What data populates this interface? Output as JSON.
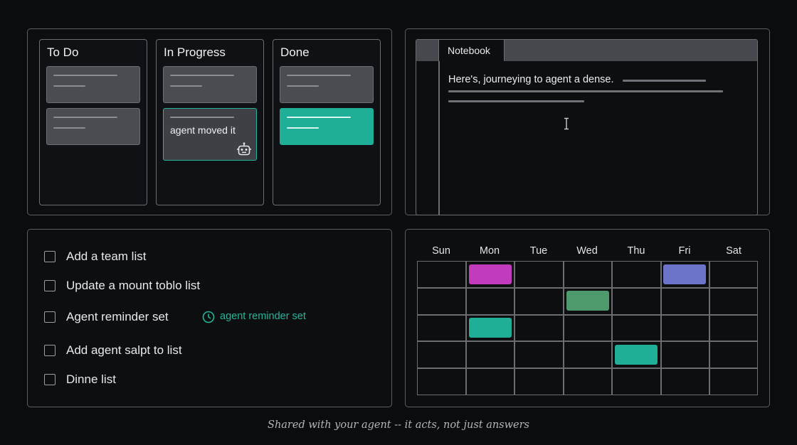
{
  "kanban": {
    "columns": [
      {
        "title": "To Do"
      },
      {
        "title": "In Progress"
      },
      {
        "title": "Done"
      }
    ],
    "agent_card_text": "agent moved it",
    "agent_icon": "robot-icon"
  },
  "notebook": {
    "tab_label": "Notebook",
    "text": "Here's, journeying to agent a dense.",
    "cursor_icon": "text-cursor-icon"
  },
  "todo": {
    "items": [
      {
        "label": "Add a team list",
        "checked": false
      },
      {
        "label": "Update a mount toblo list",
        "checked": false
      },
      {
        "label": "Agent reminder set",
        "checked": false
      },
      {
        "label": "Add agent salpt to list",
        "checked": false
      },
      {
        "label": "Dinne list",
        "checked": false
      }
    ],
    "reminder_badge": "agent reminder set",
    "reminder_icon": "clock-icon"
  },
  "calendar": {
    "days": [
      "Sun",
      "Mon",
      "Tue",
      "Wed",
      "Thu",
      "Fri",
      "Sat"
    ],
    "events": [
      {
        "day": "Mon",
        "row": 1,
        "color": "#c23bbd"
      },
      {
        "day": "Fri",
        "row": 1,
        "color": "#6b74c8"
      },
      {
        "day": "Wed",
        "row": 2,
        "color": "#4f9a6c"
      },
      {
        "day": "Mon",
        "row": 3,
        "color": "#1fae98"
      },
      {
        "day": "Thu",
        "row": 4,
        "color": "#1fae98"
      }
    ]
  },
  "caption": "Shared with your agent -- it acts, not just answers",
  "colors": {
    "accent_teal": "#25b59b",
    "card_gray": "#4a4c51",
    "background": "#0b0c0e"
  }
}
